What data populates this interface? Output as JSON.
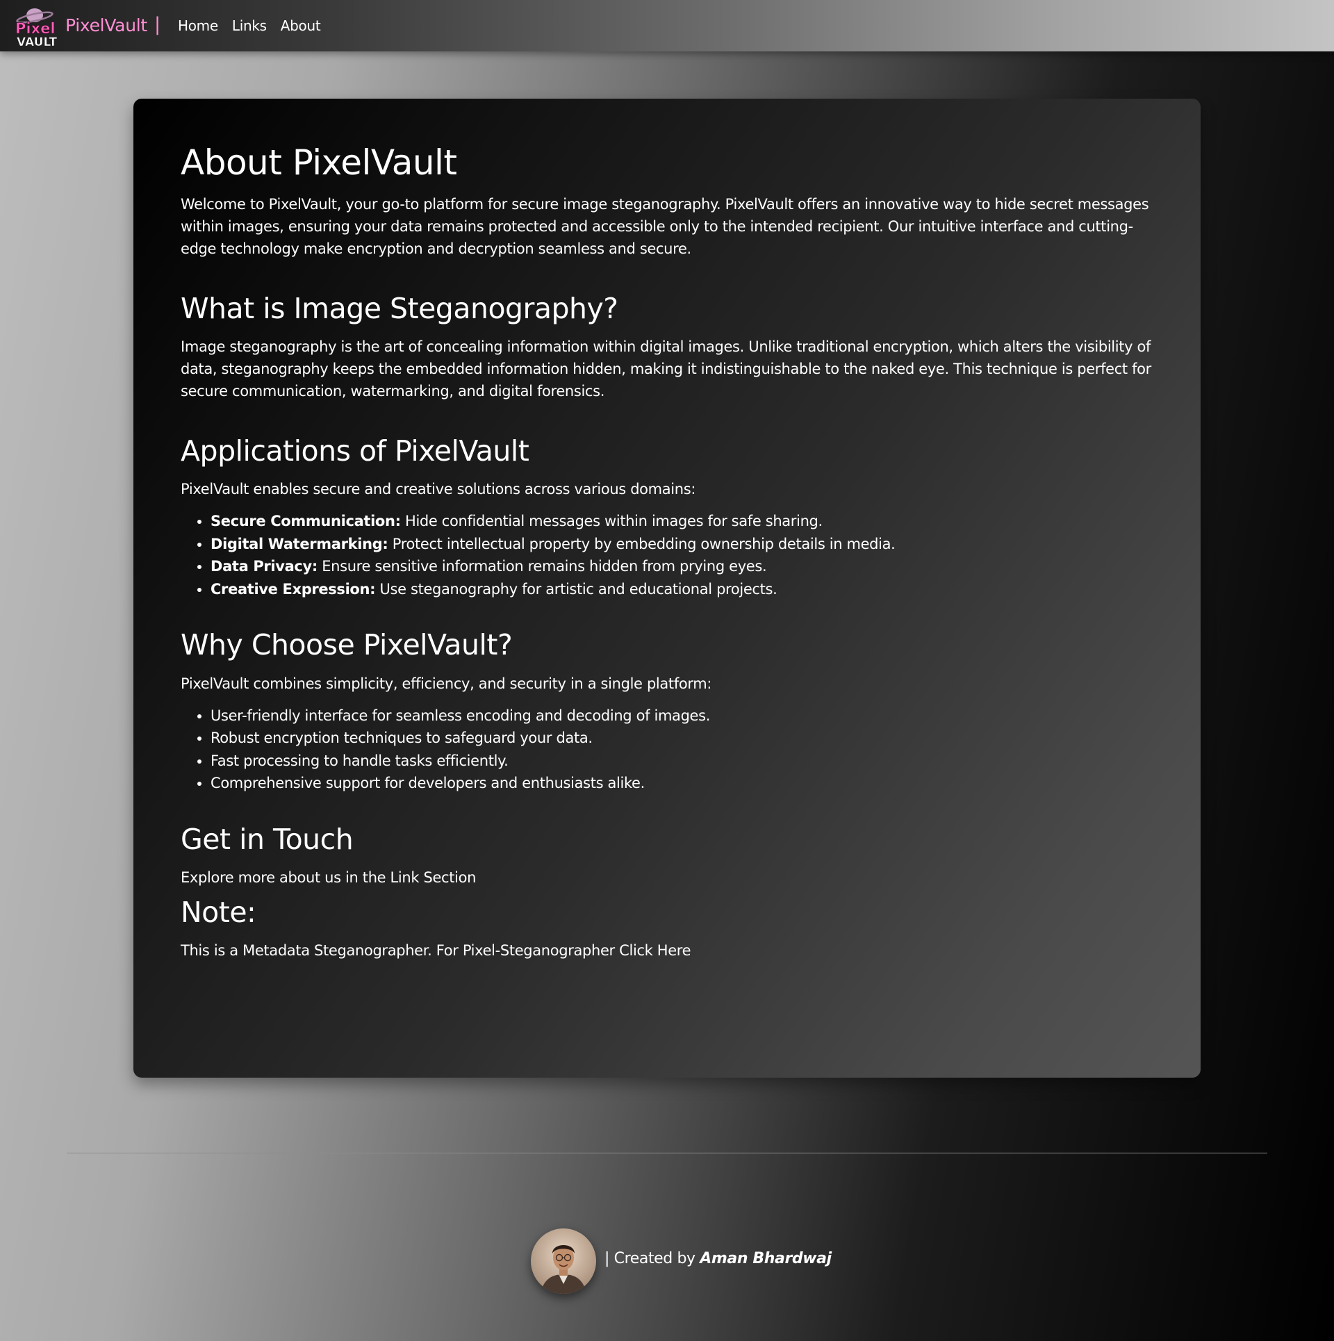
{
  "navbar": {
    "logo_text_line1": "Pixel",
    "logo_text_line2": "VAULT",
    "brand": "PixelVault",
    "separator": "|",
    "links": [
      "Home",
      "Links",
      "About"
    ]
  },
  "main": {
    "title": "About PixelVault",
    "intro": "Welcome to PixelVault, your go-to platform for secure image steganography. PixelVault offers an innovative way to hide secret messages within images, ensuring your data remains protected and accessible only to the intended recipient. Our intuitive interface and cutting-edge technology make encryption and decryption seamless and secure.",
    "what": {
      "heading": "What is Image Steganography?",
      "text": "Image steganography is the art of concealing information within digital images. Unlike traditional encryption, which alters the visibility of data, steganography keeps the embedded information hidden, making it indistinguishable to the naked eye. This technique is perfect for secure communication, watermarking, and digital forensics."
    },
    "applications": {
      "heading": "Applications of PixelVault",
      "text": "PixelVault enables secure and creative solutions across various domains:",
      "items": [
        {
          "label": "Secure Communication:",
          "text": " Hide confidential messages within images for safe sharing."
        },
        {
          "label": "Digital Watermarking:",
          "text": " Protect intellectual property by embedding ownership details in media."
        },
        {
          "label": "Data Privacy:",
          "text": " Ensure sensitive information remains hidden from prying eyes."
        },
        {
          "label": "Creative Expression:",
          "text": " Use steganography for artistic and educational projects."
        }
      ]
    },
    "why": {
      "heading": "Why Choose PixelVault?",
      "text": "PixelVault combines simplicity, efficiency, and security in a single platform:",
      "items": [
        "User-friendly interface for seamless encoding and decoding of images.",
        "Robust encryption techniques to safeguard your data.",
        "Fast processing to handle tasks efficiently.",
        "Comprehensive support for developers and enthusiasts alike."
      ]
    },
    "contact": {
      "heading": "Get in Touch",
      "text": "Explore more about us in the Link Section"
    },
    "note": {
      "heading": "Note:",
      "text_before": "This is a Metadata Steganographer. For Pixel-Steganographer ",
      "link": "Click Here"
    }
  },
  "footer": {
    "credit_prefix": "| Created by ",
    "author": "Aman Bhardwaj"
  }
}
